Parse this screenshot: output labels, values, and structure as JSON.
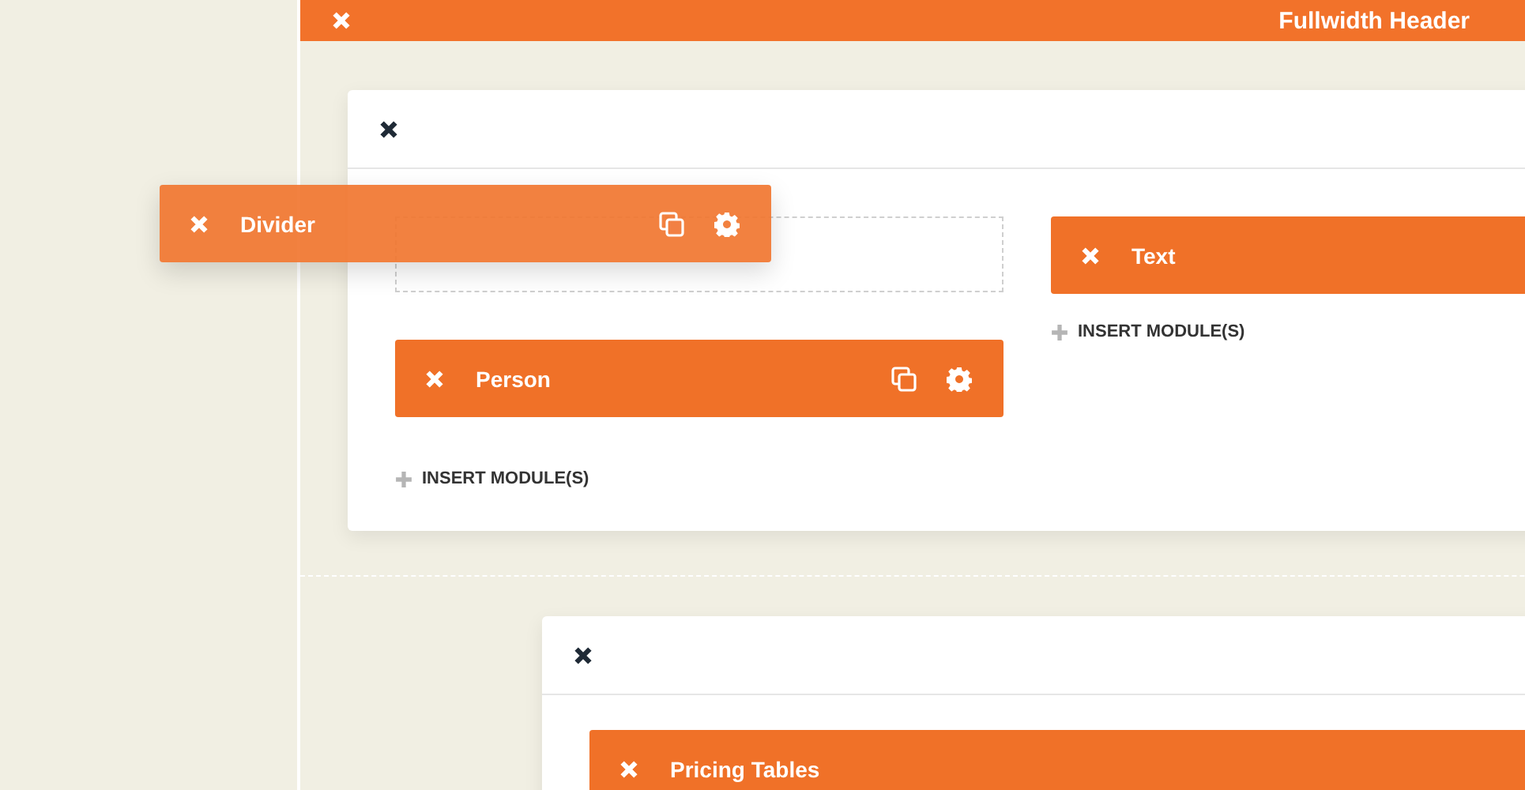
{
  "header": {
    "title": "Fullwidth Header"
  },
  "sections": [
    {
      "columns": [
        {
          "modules": [
            {
              "kind": "placeholder"
            },
            {
              "kind": "module",
              "label": "Person",
              "tools": true
            }
          ],
          "insert": "INSERT MODULE(S)"
        },
        {
          "modules": [
            {
              "kind": "module",
              "label": "Text"
            }
          ],
          "insert": "INSERT MODULE(S)"
        }
      ]
    },
    {
      "columns": [
        {
          "modules": [
            {
              "kind": "module",
              "label": "Pricing Tables"
            }
          ]
        }
      ]
    }
  ],
  "dragging": {
    "label": "Divider",
    "tools": true
  }
}
